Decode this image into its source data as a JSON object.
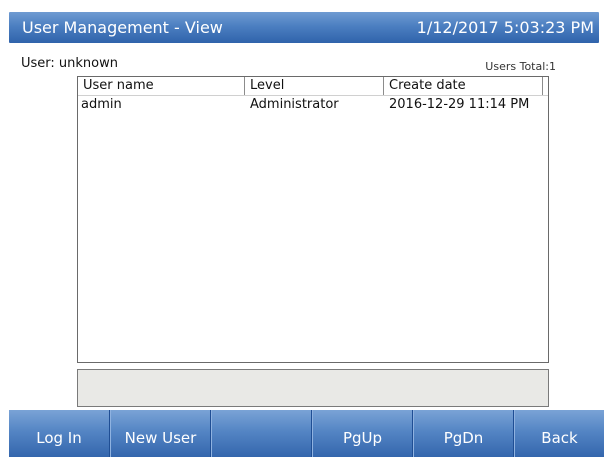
{
  "titlebar": {
    "title": "User Management - View",
    "datetime": "1/12/2017 5:03:23 PM"
  },
  "user_label": "User: unknown",
  "users_total": "Users Total:1",
  "table": {
    "columns": [
      "User name",
      "Level",
      "Create date",
      ""
    ],
    "rows": [
      {
        "user_name": "admin",
        "level": "Administrator",
        "create_date": "2016-12-29 11:14 PM"
      }
    ]
  },
  "status_text": "",
  "buttons": {
    "login": "Log In",
    "new_user": "New User",
    "blank": "",
    "pgup": "PgUp",
    "pgdn": "PgDn",
    "back": "Back"
  },
  "colors": {
    "bar_top": "#6f9bd2",
    "bar_bottom": "#2f63ab",
    "status_bg": "#e9e9e6"
  }
}
